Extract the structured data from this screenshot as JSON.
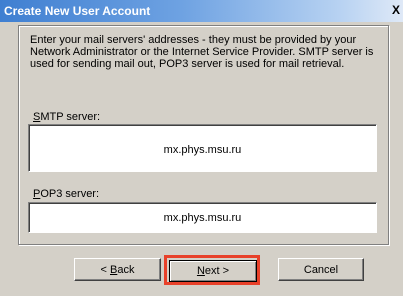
{
  "window": {
    "title": "Create New User Account",
    "close_glyph": "X"
  },
  "description": "Enter your mail servers' addresses - they must be provided by your Network Administrator or the Internet Service Provider. SMTP server is used for sending mail out, POP3 server is used for mail retrieval.",
  "smtp": {
    "label_mnemonic": "S",
    "label_rest": "MTP server:",
    "value": "mx.phys.msu.ru"
  },
  "pop3": {
    "label_mnemonic": "P",
    "label_rest": "OP3 server:",
    "value": "mx.phys.msu.ru"
  },
  "buttons": {
    "back_prefix": "< ",
    "back_mnemonic": "B",
    "back_rest": "ack",
    "next_mnemonic": "N",
    "next_rest": "ext >",
    "cancel": "Cancel"
  },
  "colors": {
    "highlight": "#e8412a",
    "titlebar": "#3f7fd1",
    "dialog_bg": "#d4d0c8"
  }
}
